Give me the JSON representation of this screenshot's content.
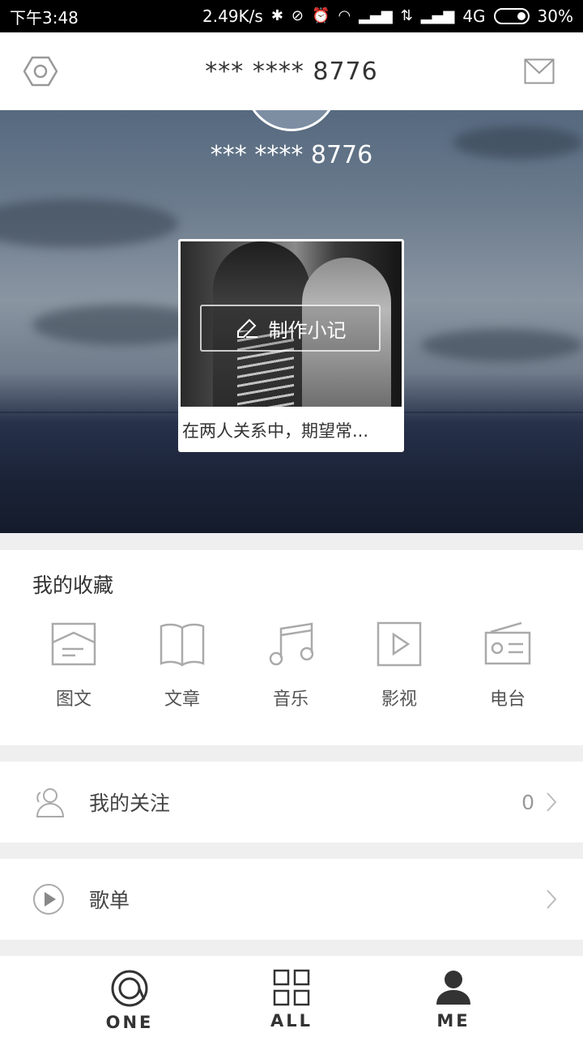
{
  "status_bar": {
    "time": "下午3:48",
    "network_speed": "2.49K/s",
    "network_type": "4G",
    "battery": "30%",
    "icons": [
      "bluetooth-icon",
      "alarm-off-icon",
      "alarm-icon",
      "wifi-icon",
      "signal-icon",
      "data-icon",
      "signal-icon",
      "battery-icon"
    ]
  },
  "header": {
    "title": "*** **** 8776",
    "left_icon": "settings-hexagon-icon",
    "right_icon": "mail-icon"
  },
  "hero": {
    "username": "*** **** 8776",
    "card": {
      "button_label": "制作小记",
      "button_icon": "pencil-icon",
      "caption": "在两人关系中，期望常..."
    }
  },
  "favorites": {
    "title": "我的收藏",
    "items": [
      {
        "label": "图文",
        "icon": "image-text-icon"
      },
      {
        "label": "文章",
        "icon": "book-icon"
      },
      {
        "label": "音乐",
        "icon": "music-icon"
      },
      {
        "label": "影视",
        "icon": "video-icon"
      },
      {
        "label": "电台",
        "icon": "radio-icon"
      }
    ]
  },
  "rows": {
    "follow": {
      "label": "我的关注",
      "count": "0",
      "icon": "user-icon"
    },
    "playlist": {
      "label": "歌单",
      "icon": "play-circle-icon"
    }
  },
  "bottom_nav": {
    "items": [
      {
        "label": "ONE",
        "icon": "one-icon"
      },
      {
        "label": "ALL",
        "icon": "grid-icon"
      },
      {
        "label": "ME",
        "icon": "person-icon",
        "active": true
      }
    ]
  }
}
